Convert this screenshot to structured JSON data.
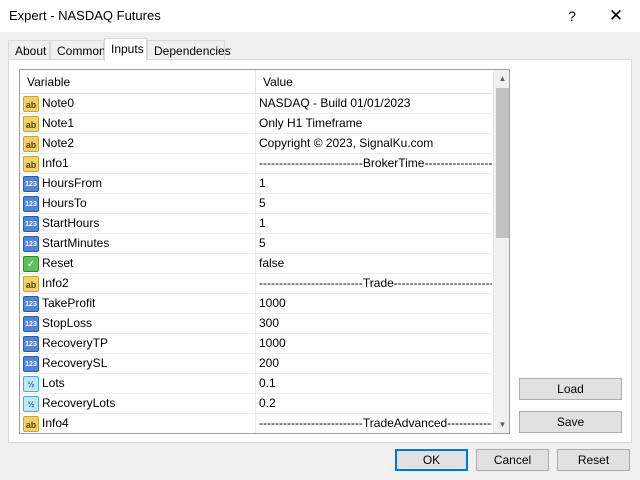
{
  "window": {
    "title": "Expert - NASDAQ Futures",
    "help_glyph": "?",
    "close_glyph": "✕"
  },
  "tabs": [
    {
      "label": "About",
      "active": false
    },
    {
      "label": "Common",
      "active": false
    },
    {
      "label": "Inputs",
      "active": true
    },
    {
      "label": "Dependencies",
      "active": false
    }
  ],
  "grid": {
    "columns": {
      "variable": "Variable",
      "value": "Value"
    },
    "rows": [
      {
        "type": "str",
        "icon": "ab",
        "icon_name": "string-type-icon",
        "name": "Note0",
        "value": "NASDAQ - Build 01/01/2023"
      },
      {
        "type": "str",
        "icon": "ab",
        "icon_name": "string-type-icon",
        "name": "Note1",
        "value": "Only H1 Timeframe"
      },
      {
        "type": "str",
        "icon": "ab",
        "icon_name": "string-type-icon",
        "name": "Note2",
        "value": "Copyright © 2023, SignalKu.com"
      },
      {
        "type": "str",
        "icon": "ab",
        "icon_name": "string-type-icon",
        "name": "Info1",
        "value": "--------------------------BrokerTime-------------------------"
      },
      {
        "type": "num",
        "icon": "123",
        "icon_name": "integer-type-icon",
        "name": "HoursFrom",
        "value": "1"
      },
      {
        "type": "num",
        "icon": "123",
        "icon_name": "integer-type-icon",
        "name": "HoursTo",
        "value": "5"
      },
      {
        "type": "num",
        "icon": "123",
        "icon_name": "integer-type-icon",
        "name": "StartHours",
        "value": "1"
      },
      {
        "type": "num",
        "icon": "123",
        "icon_name": "integer-type-icon",
        "name": "StartMinutes",
        "value": "5"
      },
      {
        "type": "bool",
        "icon": "✓",
        "icon_name": "boolean-type-icon",
        "name": "Reset",
        "value": "false"
      },
      {
        "type": "str",
        "icon": "ab",
        "icon_name": "string-type-icon",
        "name": "Info2",
        "value": "--------------------------Trade--------------------------"
      },
      {
        "type": "num",
        "icon": "123",
        "icon_name": "integer-type-icon",
        "name": "TakeProfit",
        "value": "1000"
      },
      {
        "type": "num",
        "icon": "123",
        "icon_name": "integer-type-icon",
        "name": "StopLoss",
        "value": "300"
      },
      {
        "type": "num",
        "icon": "123",
        "icon_name": "integer-type-icon",
        "name": "RecoveryTP",
        "value": "1000"
      },
      {
        "type": "num",
        "icon": "123",
        "icon_name": "integer-type-icon",
        "name": "RecoverySL",
        "value": "200"
      },
      {
        "type": "dbl",
        "icon": "½",
        "icon_name": "double-type-icon",
        "name": "Lots",
        "value": "0.1"
      },
      {
        "type": "dbl",
        "icon": "½",
        "icon_name": "double-type-icon",
        "name": "RecoveryLots",
        "value": "0.2"
      },
      {
        "type": "str",
        "icon": "ab",
        "icon_name": "string-type-icon",
        "name": "Info4",
        "value": "--------------------------TradeAdvanced----------------------..."
      }
    ]
  },
  "scrollbar": {
    "up_glyph": "▲",
    "down_glyph": "▼"
  },
  "side_buttons": {
    "load": "Load",
    "save": "Save"
  },
  "footer_buttons": {
    "ok": "OK",
    "cancel": "Cancel",
    "reset": "Reset"
  }
}
